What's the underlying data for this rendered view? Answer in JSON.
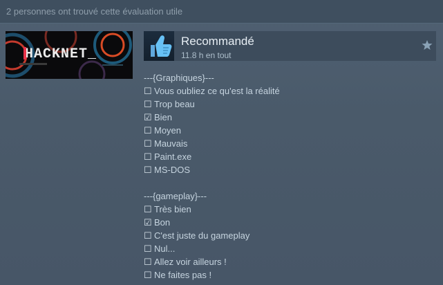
{
  "helpful_text": "2 personnes ont trouvé cette évaluation utile",
  "game": {
    "banner_text": "HACKNET_"
  },
  "review": {
    "verdict": "Recommandé",
    "hours": "11.8 h en tout"
  },
  "sections": [
    {
      "header": "---{Graphiques}---",
      "items": [
        {
          "box": "☐",
          "label": "Vous oubliez ce qu'est la réalité",
          "checked": false
        },
        {
          "box": "☐",
          "label": "Trop beau",
          "checked": false
        },
        {
          "box": "☑",
          "label": "Bien",
          "checked": true
        },
        {
          "box": "☐",
          "label": "Moyen",
          "checked": false
        },
        {
          "box": "☐",
          "label": "Mauvais",
          "checked": false
        },
        {
          "box": "☐",
          "label": "Paint.exe",
          "checked": false
        },
        {
          "box": "☐",
          "label": "MS-DOS",
          "checked": false
        }
      ]
    },
    {
      "header": "---{gameplay}---",
      "items": [
        {
          "box": "☐",
          "label": "Très bien",
          "checked": false
        },
        {
          "box": "☑",
          "label": "Bon",
          "checked": true
        },
        {
          "box": "☐",
          "label": "C'est juste du gameplay",
          "checked": false
        },
        {
          "box": "☐",
          "label": "Nul...",
          "checked": false
        },
        {
          "box": "☐",
          "label": "Allez voir ailleurs !",
          "checked": false
        },
        {
          "box": "☐",
          "label": "Ne faites pas !",
          "checked": false
        }
      ]
    }
  ],
  "icons": {
    "thumb": "thumbs-up-icon",
    "star": "star-icon"
  },
  "colors": {
    "accent": "#67c1f5",
    "banner_red": "#e8334a"
  }
}
